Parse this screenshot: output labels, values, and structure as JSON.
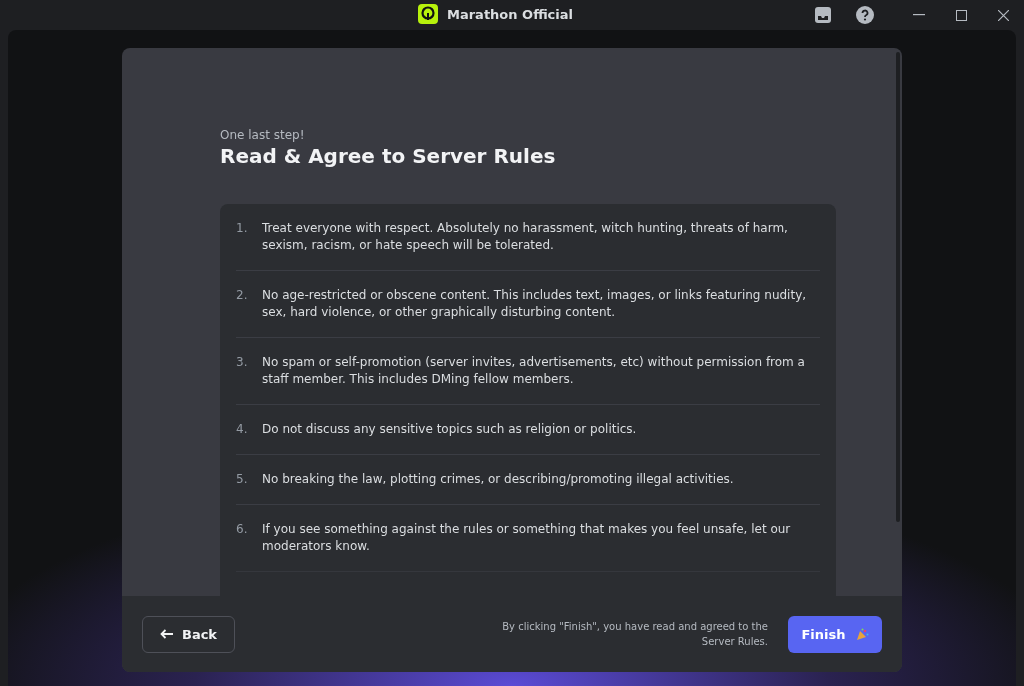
{
  "window": {
    "title": "Marathon Official"
  },
  "modal": {
    "eyebrow": "One last step!",
    "title": "Read & Agree to Server Rules",
    "rules": [
      {
        "number": "1.",
        "text": "Treat everyone with respect. Absolutely no harassment, witch hunting, threats of harm, sexism, racism, or hate speech will be tolerated."
      },
      {
        "number": "2.",
        "text": "No age-restricted or obscene content. This includes text, images, or links featuring nudity, sex, hard violence, or other graphically disturbing content."
      },
      {
        "number": "3.",
        "text": "No spam or self-promotion (server invites, advertisements, etc) without permission from a staff member. This includes DMing fellow members."
      },
      {
        "number": "4.",
        "text": "Do not discuss any sensitive topics such as religion or politics."
      },
      {
        "number": "5.",
        "text": "No breaking the law, plotting crimes, or describing/promoting illegal activities."
      },
      {
        "number": "6.",
        "text": "If you see something against the rules or something that makes you feel unsafe, let our moderators know."
      }
    ],
    "back_button": "Back",
    "notice": "By clicking \"Finish\", you have read and agreed to the Server Rules.",
    "finish_button": "Finish"
  }
}
